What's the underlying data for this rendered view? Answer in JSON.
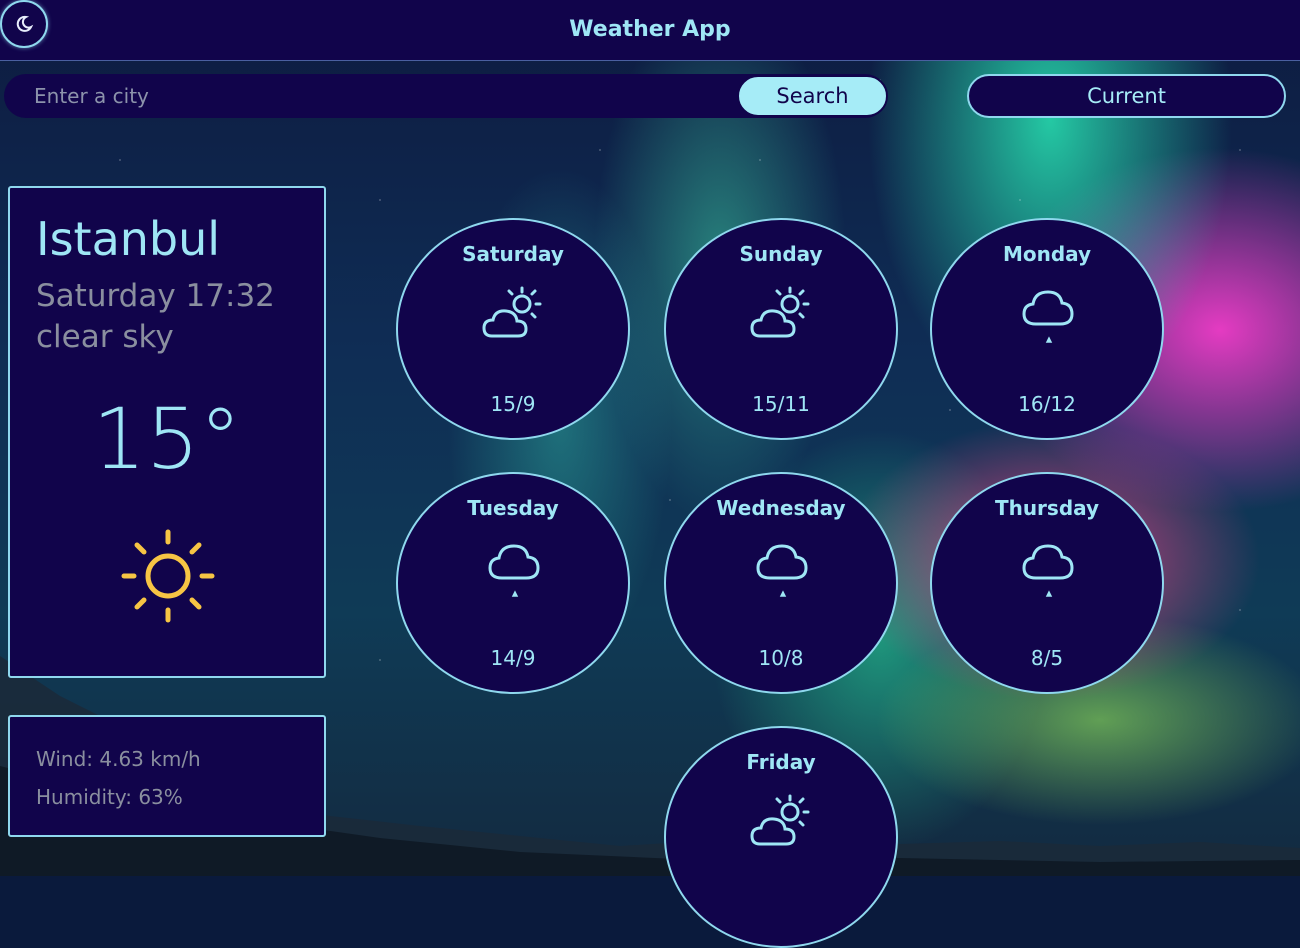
{
  "header": {
    "title": "Weather App",
    "theme_toggle_icon": "moon-icon"
  },
  "search": {
    "placeholder": "Enter a city",
    "value": "",
    "button_label": "Search"
  },
  "current_button_label": "Current",
  "current": {
    "city": "Istanbul",
    "datetime": "Saturday 17:32",
    "description": "clear sky",
    "temperature": "15°",
    "icon": "sun-icon",
    "icon_color": "#f7c544"
  },
  "details": {
    "wind": "Wind: 4.63 km/h",
    "humidity": "Humidity: 63%"
  },
  "forecast": [
    {
      "day": "Saturday",
      "icon": "partly-cloudy-icon",
      "temps": "15/9"
    },
    {
      "day": "Sunday",
      "icon": "partly-cloudy-icon",
      "temps": "15/11"
    },
    {
      "day": "Monday",
      "icon": "rain-cloud-icon",
      "temps": "16/12"
    },
    {
      "day": "Tuesday",
      "icon": "rain-cloud-icon",
      "temps": "14/9"
    },
    {
      "day": "Wednesday",
      "icon": "rain-cloud-icon",
      "temps": "10/8"
    },
    {
      "day": "Thursday",
      "icon": "rain-cloud-icon",
      "temps": "8/5"
    },
    {
      "day": "Friday",
      "icon": "partly-cloudy-icon",
      "temps": ""
    }
  ],
  "colors": {
    "panel": "#11044b",
    "accent": "#9fe6f5",
    "border": "#8fd8ee",
    "muted_text": "#8a8f9f",
    "search_button": "#a6ecf7"
  }
}
